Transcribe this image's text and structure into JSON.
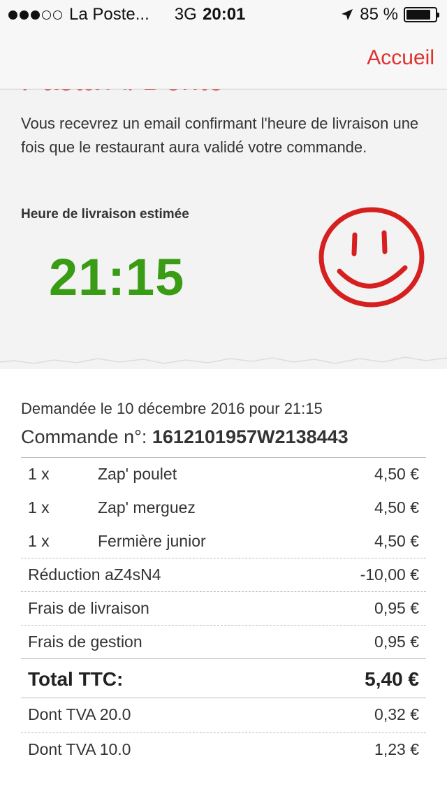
{
  "status_bar": {
    "carrier": "La Poste...",
    "network": "3G",
    "time": "20:01",
    "battery": "85 %",
    "battery_level": 0.85,
    "signal_bars_filled": 3,
    "signal_bars_total": 5
  },
  "navbar": {
    "back_label": "Accueil",
    "accent_color": "#e0302e"
  },
  "restaurant": {
    "name": "Pasta Al Dente",
    "message": "Vous recevrez un email confirmant l'heure de livraison une fois que le restaurant aura validé votre commande.",
    "eta_label": "Heure de livraison estimée",
    "eta_time": "21:15",
    "eta_color": "#3a9b14",
    "icon": "smiley-face-icon"
  },
  "order": {
    "requested": "Demandée le 10 décembre 2016 pour 21:15",
    "order_label": "Commande n°: ",
    "order_number": "1612101957W2138443",
    "items": [
      {
        "qty": "1 x",
        "name": "Zap' poulet",
        "price": "4,50 €"
      },
      {
        "qty": "1 x",
        "name": "Zap' merguez",
        "price": "4,50 €"
      },
      {
        "qty": "1 x",
        "name": "Fermière junior",
        "price": "4,50 €"
      }
    ],
    "discount": {
      "label": "Réduction aZ4sN4",
      "price": "-10,00 €"
    },
    "delivery_fee": {
      "label": "Frais de livraison",
      "price": "0,95 €"
    },
    "service_fee": {
      "label": "Frais de gestion",
      "price": "0,95 €"
    },
    "total": {
      "label": "Total TTC:",
      "price": "5,40 €"
    },
    "vat": [
      {
        "label": "Dont TVA 20.0",
        "price": "0,32 €"
      },
      {
        "label": "Dont TVA 10.0",
        "price": "1,23 €"
      }
    ]
  }
}
